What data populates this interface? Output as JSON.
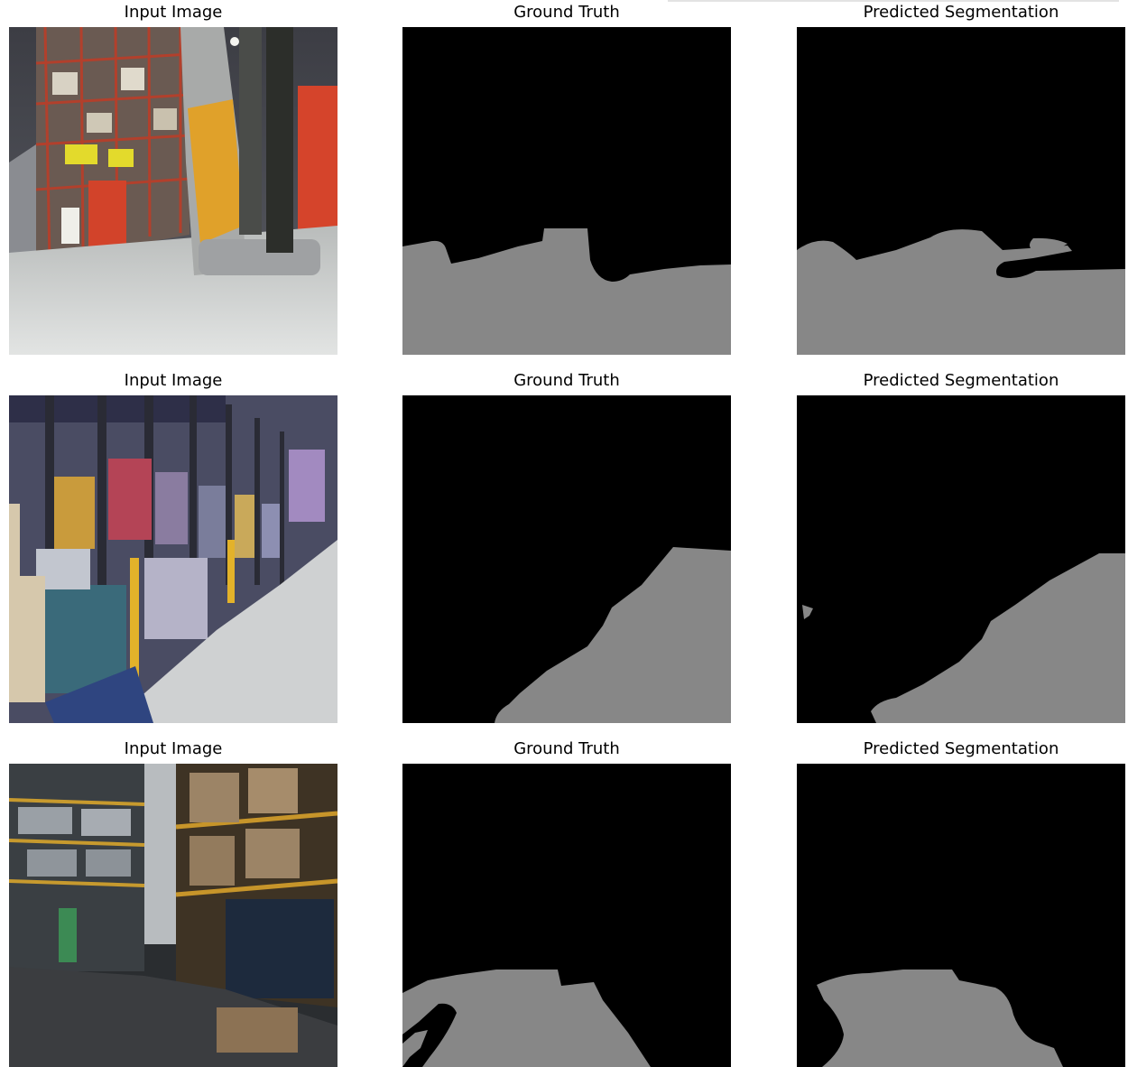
{
  "figure": {
    "rows": [
      {
        "panels": [
          {
            "title": "Input Image"
          },
          {
            "title": "Ground Truth"
          },
          {
            "title": "Predicted Segmentation"
          }
        ]
      },
      {
        "panels": [
          {
            "title": "Input Image"
          },
          {
            "title": "Ground Truth"
          },
          {
            "title": "Predicted Segmentation"
          }
        ]
      },
      {
        "panels": [
          {
            "title": "Input Image"
          },
          {
            "title": "Ground Truth"
          },
          {
            "title": "Predicted Segmentation"
          }
        ]
      }
    ],
    "colors": {
      "mask_background": "#000000",
      "mask_floor": "#878787"
    }
  }
}
